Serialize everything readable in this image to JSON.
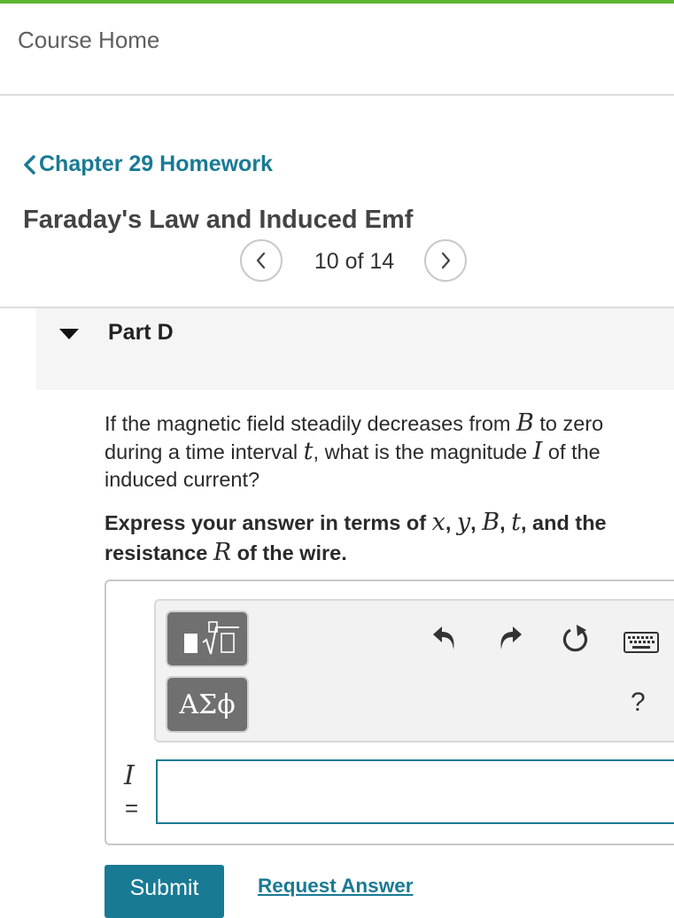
{
  "header": {
    "course_home": "Course Home"
  },
  "assignment": {
    "back_link": "Chapter 29 Homework",
    "title": "Faraday's Law and Induced Emf",
    "position": "10 of 14"
  },
  "part": {
    "label": "Part D"
  },
  "question": {
    "t1": "If the magnetic field steadily decreases from ",
    "v1": "B",
    "t2": " to zero during a time interval ",
    "v2": "t",
    "t3": ", what is the magnitude ",
    "v3": "I",
    "t4": " of the induced current?"
  },
  "instruction": {
    "t1": "Express your answer in terms of ",
    "v1": "x",
    "t2": ", ",
    "v2": "y",
    "t3": ", ",
    "v3": "B",
    "t4": ", ",
    "v4": "t",
    "t5": ", and the resistance ",
    "v5": "R",
    "t6": " of the wire."
  },
  "toolbar": {
    "greek_label": "ΑΣϕ",
    "help_label": "?",
    "icons": [
      "templates-icon",
      "undo-icon",
      "redo-icon",
      "reset-icon",
      "keyboard-icon"
    ]
  },
  "answer": {
    "variable": "I",
    "equals": "=",
    "value": ""
  },
  "actions": {
    "submit_label": "Submit",
    "request_label": "Request Answer"
  },
  "colors": {
    "accent": "#197a94",
    "topbar": "#5cb630"
  }
}
